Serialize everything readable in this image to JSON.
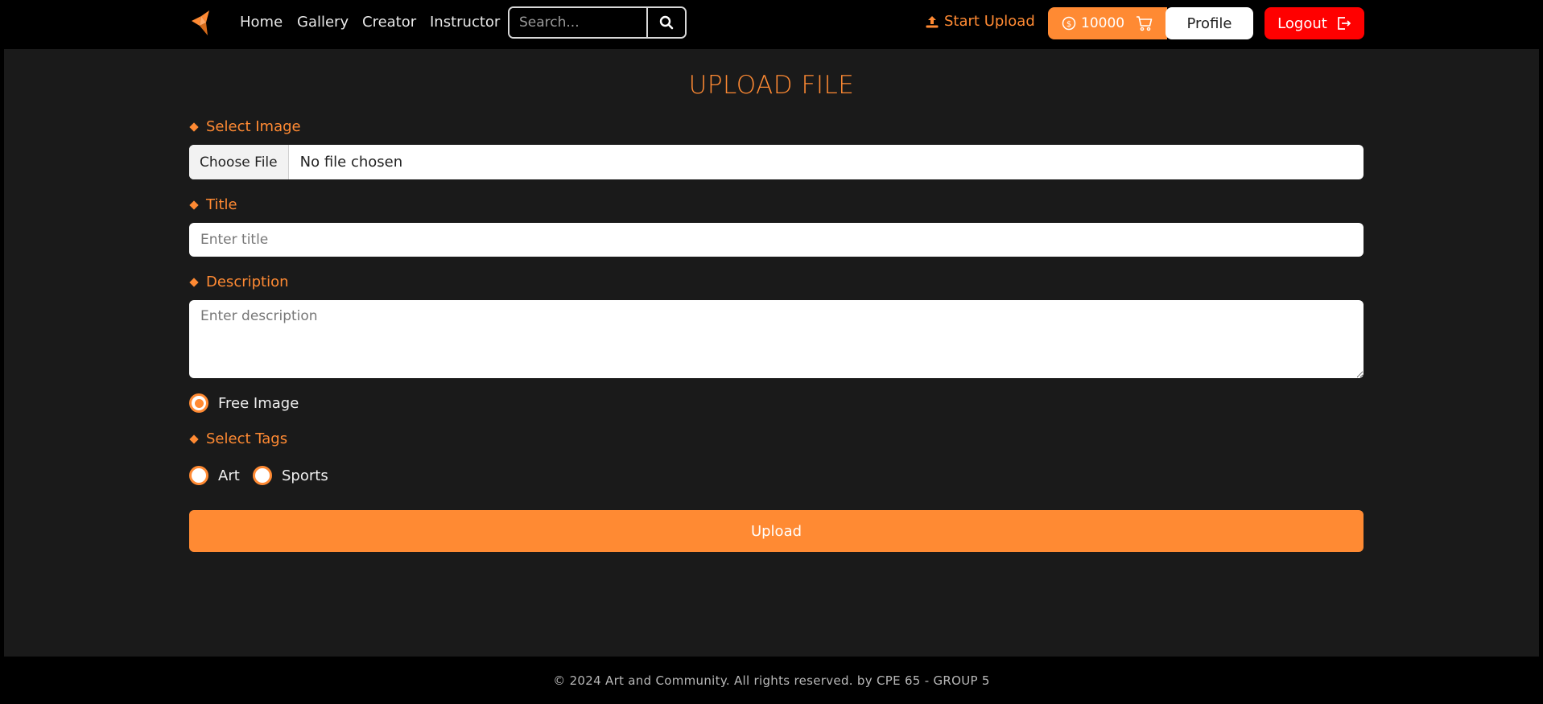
{
  "nav": {
    "links": [
      "Home",
      "Gallery",
      "Creator",
      "Instructor"
    ],
    "search_placeholder": "Search...",
    "start_upload": "Start Upload",
    "coins": "10000",
    "profile": "Profile",
    "logout": "Logout",
    "icons": {
      "logo": "origami-bird-logo",
      "search": "search-icon",
      "upload": "upload-icon",
      "coin": "coin-icon",
      "cart": "cart-icon",
      "logout": "logout-icon"
    }
  },
  "form": {
    "title": "UPLOAD FILE",
    "image_label": "Select Image",
    "choose_file": "Choose File",
    "no_file": "No file chosen",
    "title_label": "Title",
    "title_placeholder": "Enter title",
    "description_label": "Description",
    "description_placeholder": "Enter description",
    "free_image": "Free Image",
    "tags_label": "Select Tags",
    "tags": [
      "Art",
      "Sports"
    ],
    "upload_button": "Upload"
  },
  "footer": {
    "text": "© 2024 Art and Community. All rights reserved. by CPE 65 - GROUP 5"
  },
  "colors": {
    "accent": "#ff8a33",
    "logout": "#ff0000",
    "background": "#1a1a1a",
    "navbar": "#000000"
  }
}
